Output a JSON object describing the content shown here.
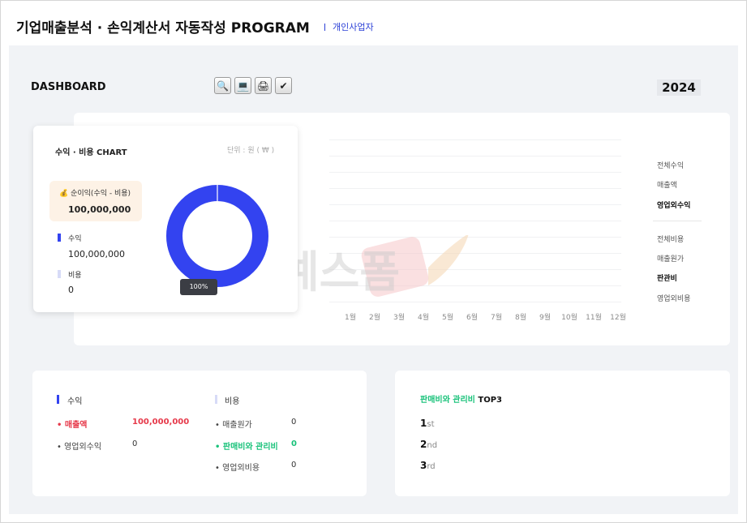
{
  "header": {
    "title": "기업매출분석 · 손익계산서 자동작성 PROGRAM",
    "subtitle": "개인사업자"
  },
  "dashboard": {
    "title": "DASHBOARD",
    "year": "2024",
    "toolbar": [
      {
        "icon": "search-icon",
        "glyph": "🔍"
      },
      {
        "icon": "laptop-icon",
        "glyph": "💻"
      },
      {
        "icon": "printer-icon",
        "glyph": "🖨"
      },
      {
        "icon": "check-icon",
        "glyph": "✔"
      }
    ]
  },
  "pie_card": {
    "title": "수익 · 비용 CHART",
    "unit": "단위 : 원 ( ₩ )",
    "net_label": "순이익(수익 - 비용)",
    "net_value": "100,000,000",
    "revenue_label": "수익",
    "revenue_value": "100,000,000",
    "expense_label": "비용",
    "expense_value": "0",
    "tooltip": "100%",
    "colors": {
      "revenue": "#3343f0",
      "expense": "#d7dbf7",
      "net_bg": "#fdf2e6"
    }
  },
  "chart_data": {
    "type": "bar",
    "categories": [
      "1월",
      "2월",
      "3월",
      "4월",
      "5월",
      "6월",
      "7월",
      "8월",
      "9월",
      "10월",
      "11월",
      "12월"
    ],
    "series": [],
    "grid": true
  },
  "side_menu": {
    "income": [
      {
        "label": "전체수익",
        "active": false
      },
      {
        "label": "매출액",
        "active": false
      },
      {
        "label": "영업외수익",
        "active": true
      }
    ],
    "expense": [
      {
        "label": "전체비용",
        "active": false
      },
      {
        "label": "매출원가",
        "active": false
      },
      {
        "label": "판관비",
        "active": true
      },
      {
        "label": "영업외비용",
        "active": false
      }
    ]
  },
  "summary": {
    "income_title": "수익",
    "income_rows": [
      {
        "label": "매출액",
        "value": "100,000,000",
        "highlight": "red"
      },
      {
        "label": "영업외수익",
        "value": "0",
        "highlight": ""
      }
    ],
    "expense_title": "비용",
    "expense_rows": [
      {
        "label": "매출원가",
        "value": "0",
        "highlight": ""
      },
      {
        "label": "판매비와 관리비",
        "value": "0",
        "highlight": "green"
      },
      {
        "label": "영업외비용",
        "value": "0",
        "highlight": ""
      }
    ]
  },
  "top3": {
    "title_highlight": "판매비와 관리비",
    "title_rest": " TOP3",
    "ranks": [
      {
        "num": "1",
        "suffix": "st"
      },
      {
        "num": "2",
        "suffix": "nd"
      },
      {
        "num": "3",
        "suffix": "rd"
      }
    ]
  },
  "watermark": "예스폼"
}
